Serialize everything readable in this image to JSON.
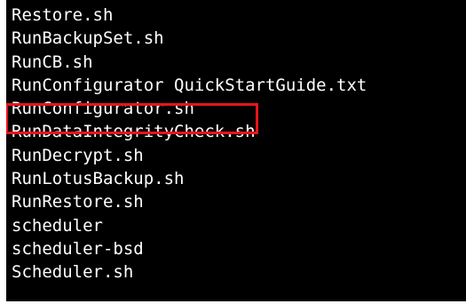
{
  "terminal": {
    "entries": [
      "Restore.sh",
      "RunBackupSet.sh",
      "RunCB.sh",
      "RunConfigurator QuickStartGuide.txt",
      "RunConfigurator.sh",
      "RunDataIntegrityCheck.sh",
      "RunDecrypt.sh",
      "RunLotusBackup.sh",
      "RunRestore.sh",
      "scheduler",
      "scheduler-bsd",
      "Scheduler.sh"
    ],
    "highlighted_entry": "RunConfigurator.sh",
    "colors": {
      "background": "#000000",
      "text": "#ffffff",
      "highlight": "#e8141c"
    }
  }
}
